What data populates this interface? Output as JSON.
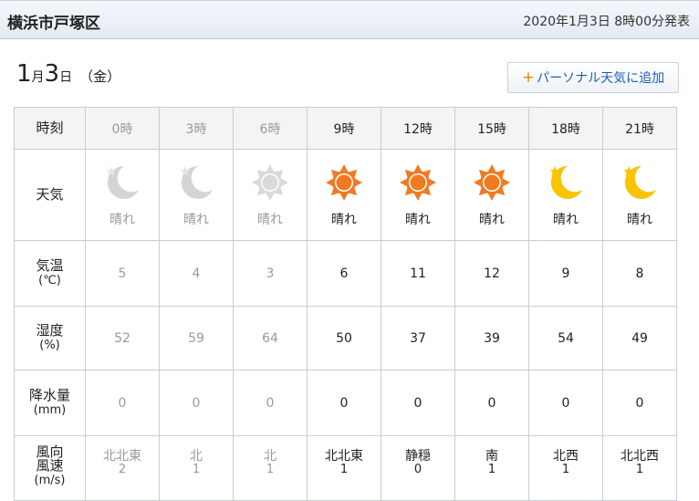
{
  "header": {
    "location": "横浜市戸塚区",
    "issued": "2020年1月3日 8時00分発表"
  },
  "date": {
    "month": "1",
    "month_unit": "月",
    "day": "3",
    "day_unit": "日",
    "weekday": "（金）"
  },
  "add_button": {
    "plus": "+",
    "label": "パーソナル天気に追加"
  },
  "rows": {
    "time_label": "時刻",
    "weather_label": "天気",
    "temp_label": "気温",
    "temp_unit": "(℃)",
    "humidity_label": "湿度",
    "humidity_unit": "(%)",
    "precip_label": "降水量",
    "precip_unit": "(mm)",
    "wind_label1": "風向",
    "wind_label2": "風速",
    "wind_unit": "(m/s)"
  },
  "forecast": [
    {
      "time": "0時",
      "weather": "晴れ",
      "icon": "moon-icon",
      "temp": "5",
      "humidity": "52",
      "precip": "0",
      "wind_dir": "北北東",
      "wind_speed": "2",
      "past": true
    },
    {
      "time": "3時",
      "weather": "晴れ",
      "icon": "moon-icon",
      "temp": "4",
      "humidity": "59",
      "precip": "0",
      "wind_dir": "北",
      "wind_speed": "1",
      "past": true
    },
    {
      "time": "6時",
      "weather": "晴れ",
      "icon": "sun-icon",
      "temp": "3",
      "humidity": "64",
      "precip": "0",
      "wind_dir": "北",
      "wind_speed": "1",
      "past": true
    },
    {
      "time": "9時",
      "weather": "晴れ",
      "icon": "sun-icon",
      "temp": "6",
      "humidity": "50",
      "precip": "0",
      "wind_dir": "北北東",
      "wind_speed": "1",
      "past": false
    },
    {
      "time": "12時",
      "weather": "晴れ",
      "icon": "sun-icon",
      "temp": "11",
      "humidity": "37",
      "precip": "0",
      "wind_dir": "静穏",
      "wind_speed": "0",
      "past": false
    },
    {
      "time": "15時",
      "weather": "晴れ",
      "icon": "sun-icon",
      "temp": "12",
      "humidity": "39",
      "precip": "0",
      "wind_dir": "南",
      "wind_speed": "1",
      "past": false
    },
    {
      "time": "18時",
      "weather": "晴れ",
      "icon": "moon-icon",
      "temp": "9",
      "humidity": "54",
      "precip": "0",
      "wind_dir": "北西",
      "wind_speed": "1",
      "past": false
    },
    {
      "time": "21時",
      "weather": "晴れ",
      "icon": "moon-icon",
      "temp": "8",
      "humidity": "49",
      "precip": "0",
      "wind_dir": "北北西",
      "wind_speed": "1",
      "past": false
    }
  ],
  "colors": {
    "sun_past": "#d9d9d9",
    "sun_now": "#f07a22",
    "moon_past": "#d4d4d4",
    "moon_now": "#f8c400",
    "past_text": "#999999"
  }
}
